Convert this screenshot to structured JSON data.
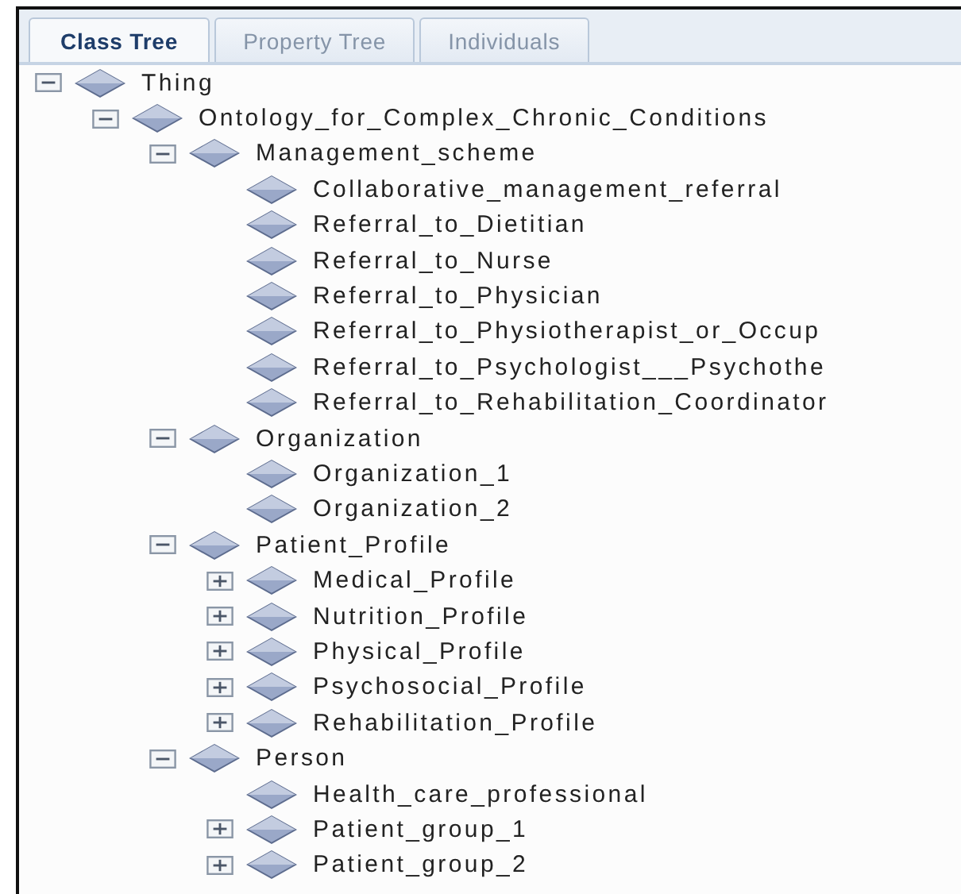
{
  "tabs": [
    {
      "label": "Class Tree",
      "selected": true
    },
    {
      "label": "Property Tree",
      "selected": false
    },
    {
      "label": "Individuals",
      "selected": false
    }
  ],
  "tree": [
    {
      "label": "Thing",
      "expanded": true,
      "children": [
        {
          "label": "Ontology_for_Complex_Chronic_Conditions",
          "expanded": true,
          "children": [
            {
              "label": "Management_scheme",
              "expanded": true,
              "children": [
                {
                  "label": "Collaborative_management_referral"
                },
                {
                  "label": "Referral_to_Dietitian"
                },
                {
                  "label": "Referral_to_Nurse"
                },
                {
                  "label": "Referral_to_Physician"
                },
                {
                  "label": "Referral_to_Physiotherapist_or_Occup"
                },
                {
                  "label": "Referral_to_Psychologist___Psychothe"
                },
                {
                  "label": "Referral_to_Rehabilitation_Coordinator"
                }
              ]
            },
            {
              "label": "Organization",
              "expanded": true,
              "children": [
                {
                  "label": "Organization_1"
                },
                {
                  "label": "Organization_2"
                }
              ]
            },
            {
              "label": "Patient_Profile",
              "expanded": true,
              "children": [
                {
                  "label": "Medical_Profile",
                  "expanded": false
                },
                {
                  "label": "Nutrition_Profile",
                  "expanded": false
                },
                {
                  "label": "Physical_Profile",
                  "expanded": false
                },
                {
                  "label": "Psychosocial_Profile",
                  "expanded": false
                },
                {
                  "label": "Rehabilitation_Profile",
                  "expanded": false
                }
              ]
            },
            {
              "label": "Person",
              "expanded": true,
              "children": [
                {
                  "label": "Health_care_professional"
                },
                {
                  "label": "Patient_group_1",
                  "expanded": false
                },
                {
                  "label": "Patient_group_2",
                  "expanded": false
                }
              ]
            }
          ]
        }
      ]
    }
  ]
}
